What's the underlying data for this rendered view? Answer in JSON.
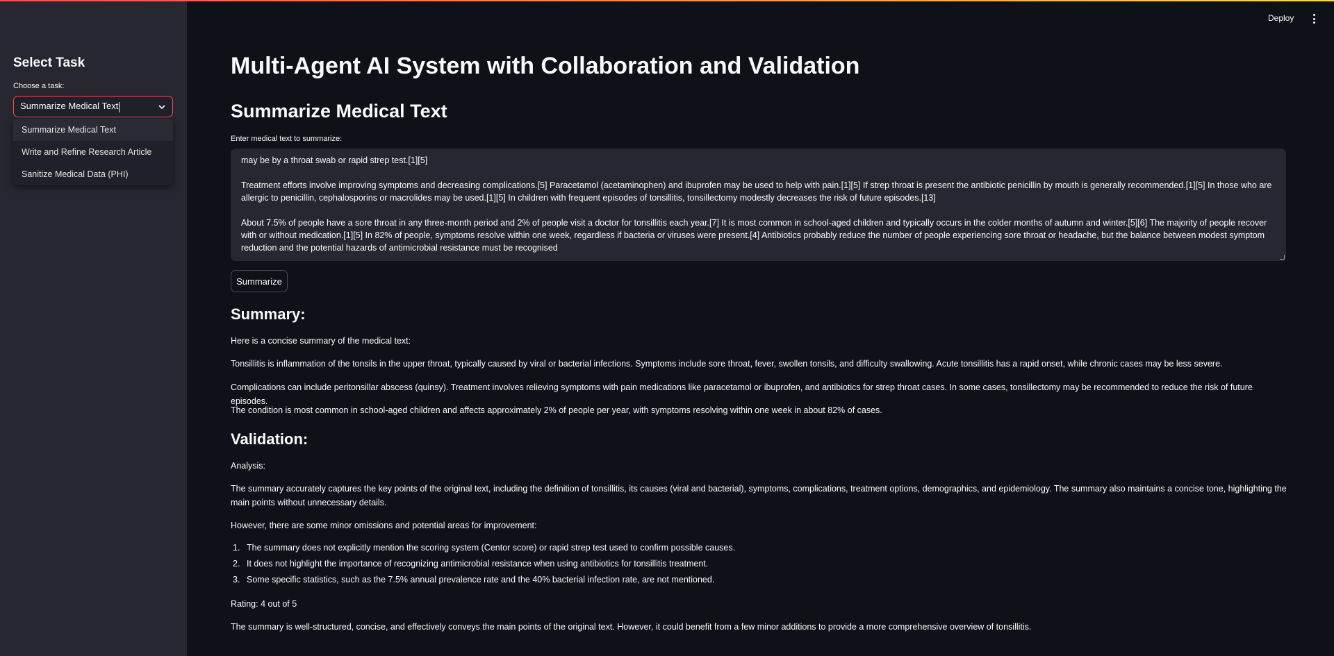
{
  "sidebar": {
    "title": "Select Task",
    "choose_label": "Choose a task:",
    "selected": "Summarize Medical Text",
    "options": [
      "Summarize Medical Text",
      "Write and Refine Research Article",
      "Sanitize Medical Data (PHI)"
    ]
  },
  "header": {
    "deploy_label": "Deploy",
    "menu_icon": "kebab-menu-icon"
  },
  "main": {
    "title": "Multi-Agent AI System with Collaboration and Validation",
    "subtitle": "Summarize Medical Text",
    "input_label": "Enter medical text to summarize:",
    "input_paragraphs": [
      "may be by a throat swab or rapid strep test.[1][5]",
      "Treatment efforts involve improving symptoms and decreasing complications.[5] Paracetamol (acetaminophen) and ibuprofen may be used to help with pain.[1][5] If strep throat is present the antibiotic penicillin by mouth is generally recommended.[1][5] In those who are allergic to penicillin, cephalosporins or macrolides may be used.[1][5] In children with frequent episodes of tonsillitis, tonsillectomy modestly decreases the risk of future episodes.[13]",
      "About 7.5% of people have a sore throat in any three-month period and 2% of people visit a doctor for tonsillitis each year.[7] It is most common in school-aged children and typically occurs in the colder months of autumn and winter.[5][6] The majority of people recover with or without medication.[1][5] In 82% of people, symptoms resolve within one week, regardless if bacteria or viruses were present.[4] Antibiotics probably reduce the number of people experiencing sore throat or headache, but the balance between modest symptom reduction and the potential hazards of antimicrobial resistance must be recognised"
    ],
    "summarize_button": "Summarize",
    "summary_heading": "Summary:",
    "summary_paragraphs": [
      "Here is a concise summary of the medical text:",
      "Tonsillitis is inflammation of the tonsils in the upper throat, typically caused by viral or bacterial infections. Symptoms include sore throat, fever, swollen tonsils, and difficulty swallowing. Acute tonsillitis has a rapid onset, while chronic cases may be less severe.",
      "Complications can include peritonsillar abscess (quinsy). Treatment involves relieving symptoms with pain medications like paracetamol or ibuprofen, and antibiotics for strep throat cases. In some cases, tonsillectomy may be recommended to reduce the risk of future episodes.",
      "The condition is most common in school-aged children and affects approximately 2% of people per year, with symptoms resolving within one week in about 82% of cases."
    ],
    "validation_heading": "Validation:",
    "validation": {
      "analysis_label": "Analysis:",
      "analysis_text": "The summary accurately captures the key points of the original text, including the definition of tonsillitis, its causes (viral and bacterial), symptoms, complications, treatment options, demographics, and epidemiology. The summary also maintains a concise tone, highlighting the main points without unnecessary details.",
      "omissions_intro": "However, there are some minor omissions and potential areas for improvement:",
      "items": [
        {
          "num": "1.",
          "text": "The summary does not explicitly mention the scoring system (Centor score) or rapid strep test used to confirm possible causes."
        },
        {
          "num": "2.",
          "text": "It does not highlight the importance of recognizing antimicrobial resistance when using antibiotics for tonsillitis treatment."
        },
        {
          "num": "3.",
          "text": "Some specific statistics, such as the 7.5% annual prevalence rate and the 40% bacterial infection rate, are not mentioned."
        }
      ],
      "rating": "Rating: 4 out of 5",
      "conclusion": "The summary is well-structured, concise, and effectively conveys the main points of the original text. However, it could benefit from a few minor additions to provide a more comprehensive overview of tonsillitis."
    }
  }
}
